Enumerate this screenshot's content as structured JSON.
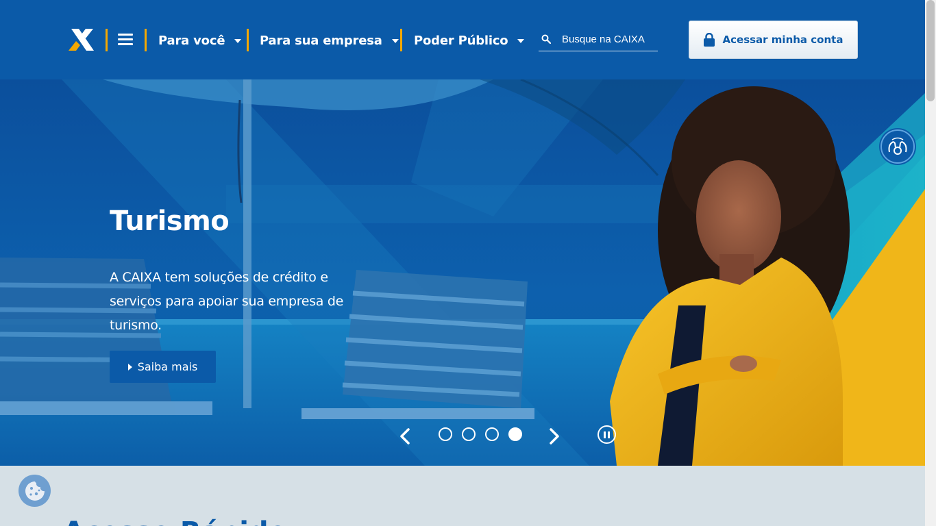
{
  "header": {
    "logo": "caixa-x-logo",
    "menu_icon": "hamburger-menu-icon",
    "nav": [
      {
        "label": "Para você"
      },
      {
        "label": "Para sua empresa"
      },
      {
        "label": "Poder Público"
      }
    ],
    "search": {
      "placeholder": "Busque na CAIXA",
      "icon": "search-icon"
    },
    "login": {
      "label": "Acessar minha conta",
      "icon": "lock-icon"
    }
  },
  "hero": {
    "title": "Turismo",
    "text": "A CAIXA tem soluções de crédito e serviços para apoiar sua empresa de turismo.",
    "cta": "Saiba mais",
    "slides_total": 4,
    "active_slide": 4
  },
  "accessibility": {
    "libras_icon": "sign-language-hands-icon"
  },
  "cookie": {
    "icon": "cookie-icon"
  },
  "section": {
    "heading": "Acesso Rápido"
  },
  "colors": {
    "brand_blue": "#0b5aa8",
    "accent_orange": "#f5a800",
    "jacket_yellow": "#f2b616"
  }
}
